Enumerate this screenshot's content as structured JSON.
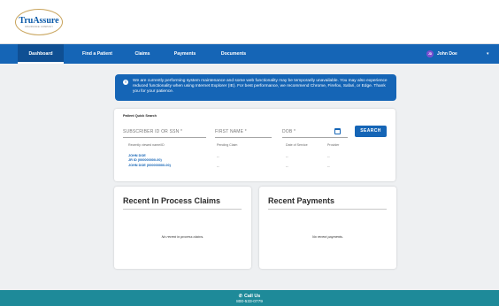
{
  "brand": {
    "logo_text": "TruAssure",
    "logo_subtext": "INSURANCE COMPANY"
  },
  "nav": {
    "items": [
      {
        "label": "Dashboard",
        "active": true
      },
      {
        "label": "Find a Patient"
      },
      {
        "label": "Claims"
      },
      {
        "label": "Payments"
      },
      {
        "label": "Documents"
      }
    ],
    "user": {
      "initials": "JD",
      "name": "John Doe"
    },
    "caret_icon": "chevron-down-icon"
  },
  "notice": {
    "icon": "info-icon",
    "icon_glyph": "!",
    "text": "We are currently performing system maintenance and some web functionality may be temporarily unavailable. You may also experience reduced functionality when using Internet Explorer (IE). For best performance, we recommend Chrome, Firefox, Safari, or Edge. Thank you for your patience."
  },
  "quick_search": {
    "heading": "Patient Quick Search",
    "fields": {
      "subscriber": "SUBSCRIBER ID OR SSN *",
      "first_name": "FIRST NAME *",
      "dob": "DOB *"
    },
    "button_label": "SEARCH",
    "columns": [
      "Recently viewed name/ID",
      "Pending Claim",
      "Date of Service",
      "Provider"
    ],
    "rows": [
      {
        "name_line1": "JOHN DOE",
        "name_line2": "JR ID (000000000-00)",
        "claim": "--",
        "date": "--",
        "provider": "--"
      },
      {
        "name_line1": "JOHN DOE (000000000-00)",
        "claim": "--",
        "date": "--",
        "provider": "--"
      }
    ]
  },
  "recent_claims": {
    "title": "Recent In Process Claims",
    "empty": "No recent in process claims."
  },
  "recent_payments": {
    "title": "Recent Payments",
    "empty": "No recent payments."
  },
  "footer": {
    "call_label": "Call Us",
    "phone": "800-533-0779"
  },
  "colors": {
    "primary": "#1565b6",
    "footer": "#1e8a99",
    "background": "#eef0f2",
    "avatar": "#7b4fd0"
  }
}
